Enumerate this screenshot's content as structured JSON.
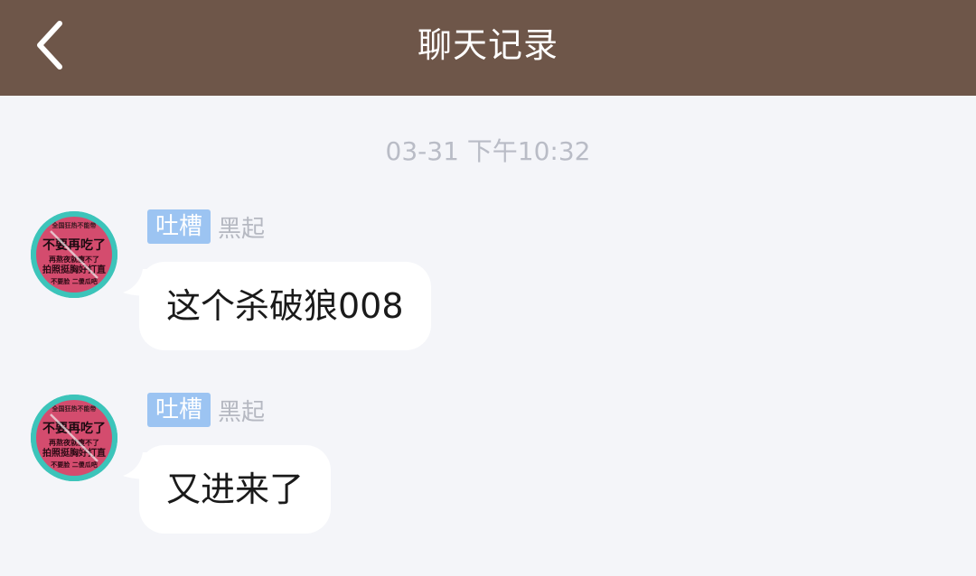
{
  "header": {
    "title": "聊天记录",
    "background": "#6e5649"
  },
  "timestamp": "03-31 下午10:32",
  "messages": [
    {
      "tag": "吐槽",
      "nickname": "黑起",
      "text": "这个杀破狼008",
      "avatar": {
        "top_text": "全国狂热不能带",
        "main_text": "不要再吃了",
        "line2": "再熬夜就瘦不了",
        "line3": "拍照挺胸好打直",
        "bottom_text": "不要脸 二傻瓜吧"
      }
    },
    {
      "tag": "吐槽",
      "nickname": "黑起",
      "text": "又进来了",
      "avatar": {
        "top_text": "全国狂热不能带",
        "main_text": "不要再吃了",
        "line2": "再熬夜就瘦不了",
        "line3": "拍照挺胸好打直",
        "bottom_text": "不要脸 二傻瓜吧"
      }
    }
  ],
  "colors": {
    "background": "#f4f5f9",
    "tag": "#9cc4f2",
    "avatar_ring": "#3cc4ba",
    "avatar_fill": "#d44c6e"
  }
}
